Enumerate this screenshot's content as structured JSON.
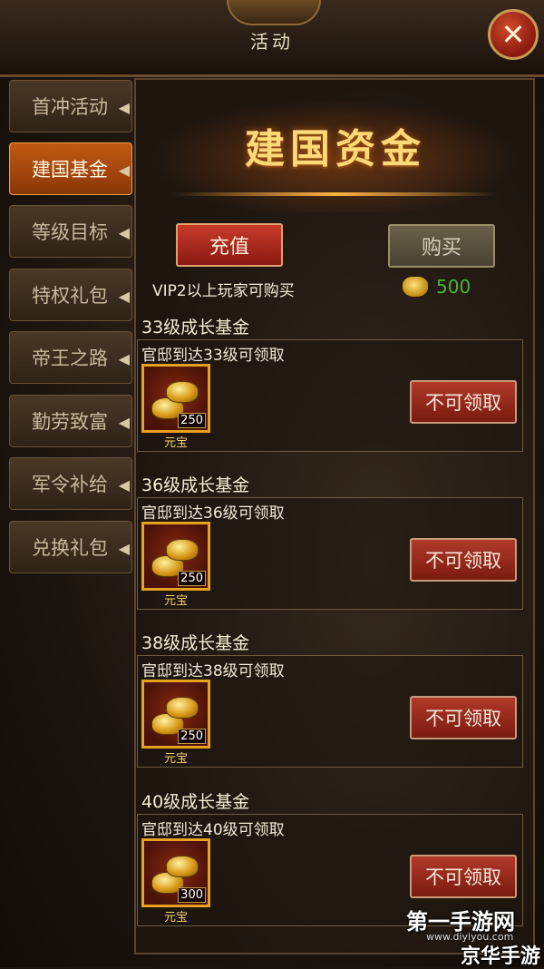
{
  "header": {
    "title": "活动"
  },
  "sidebar": {
    "items": [
      {
        "label": "首冲活动",
        "active": false
      },
      {
        "label": "建国基金",
        "active": true
      },
      {
        "label": "等级目标",
        "active": false
      },
      {
        "label": "特权礼包",
        "active": false
      },
      {
        "label": "帝王之路",
        "active": false
      },
      {
        "label": "勤劳致富",
        "active": false
      },
      {
        "label": "军令补给",
        "active": false
      },
      {
        "label": "兑换礼包",
        "active": false
      }
    ]
  },
  "main": {
    "banner_title": "建国资金",
    "recharge_label": "充值",
    "buy_label": "购买",
    "vip_note": "VIP2以上玩家可购买",
    "price": "500",
    "funds": [
      {
        "title": "33级成长基金",
        "condition": "官邸到达33级可领取",
        "item_name": "元宝",
        "item_count": "250",
        "button": "不可领取"
      },
      {
        "title": "36级成长基金",
        "condition": "官邸到达36级可领取",
        "item_name": "元宝",
        "item_count": "250",
        "button": "不可领取"
      },
      {
        "title": "38级成长基金",
        "condition": "官邸到达38级可领取",
        "item_name": "元宝",
        "item_count": "250",
        "button": "不可领取"
      },
      {
        "title": "40级成长基金",
        "condition": "官邸到达40级可领取",
        "item_name": "元宝",
        "item_count": "300",
        "button": "不可领取"
      }
    ]
  },
  "watermark": {
    "line1": "第一手游网",
    "line2": "www.diyiyou.com",
    "line3": "京华手游"
  },
  "colors": {
    "accent": "#c25a12",
    "price_green": "#4ab23a",
    "gold": "#ffd878"
  }
}
